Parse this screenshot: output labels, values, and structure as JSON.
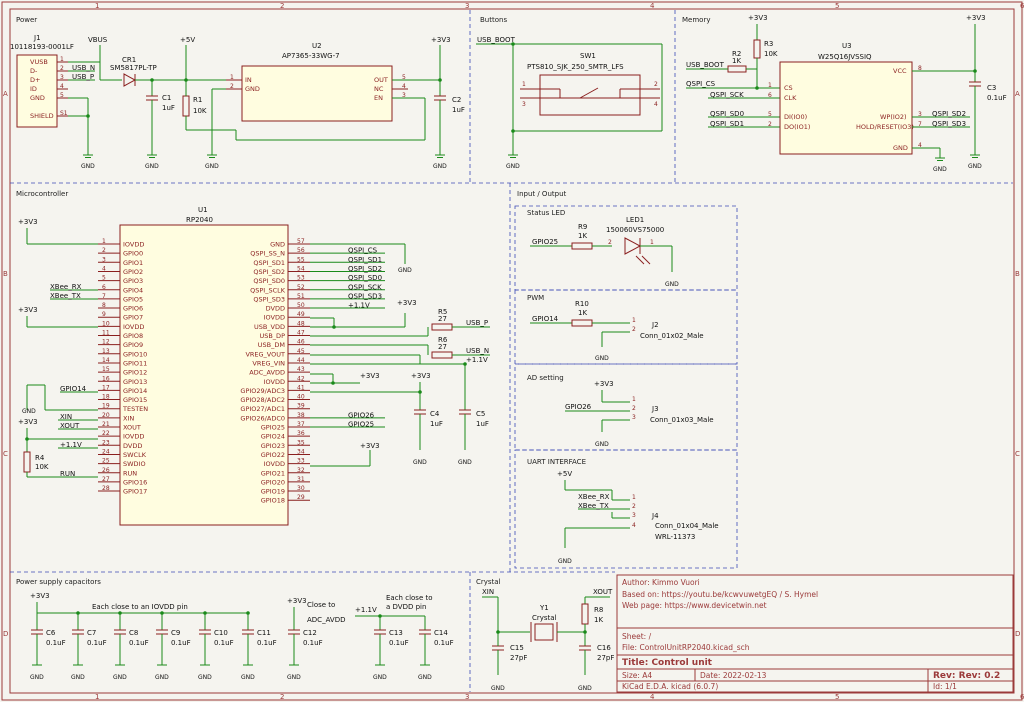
{
  "sections": {
    "power": "Power",
    "buttons": "Buttons",
    "memory": "Memory",
    "microcontroller": "Microcontroller",
    "io": "Input / Output",
    "status_led": "Status LED",
    "pwm": "PWM",
    "ad_setting": "AD setting",
    "uart": "UART INTERFACE",
    "power_caps": "Power supply capacitors",
    "crystal": "Crystal"
  },
  "grid_cols": [
    "1",
    "2",
    "3",
    "4",
    "5",
    "6"
  ],
  "grid_rows": [
    "A",
    "B",
    "C",
    "D"
  ],
  "power": {
    "j1_ref": "J1",
    "j1_val": "10118193-0001LF",
    "j1_pins": [
      "VUSB",
      "D-",
      "D+",
      "ID",
      "GND",
      "SHIELD"
    ],
    "j1_pnums": [
      "1",
      "2",
      "3",
      "4",
      "5",
      "S1"
    ],
    "vbus": "VBUS",
    "usb_n": "USB_N",
    "usb_p": "USB_P",
    "cr1_ref": "CR1",
    "cr1_val": "SM5817PL-TP",
    "p5v": "+5V",
    "c1_ref": "C1",
    "c1_val": "1uF",
    "r1_ref": "R1",
    "r1_val": "10K",
    "u2_ref": "U2",
    "u2_val": "AP7365-33WG-7",
    "u2_left": [
      "IN",
      "GND"
    ],
    "u2_right": [
      "OUT",
      "NC",
      "EN"
    ],
    "u2_lnums": [
      "1",
      "2"
    ],
    "u2_rnums": [
      "5",
      "4",
      "3"
    ],
    "p3v3": "+3V3",
    "c2_ref": "C2",
    "c2_val": "1uF",
    "gnd": "GND"
  },
  "buttons": {
    "usb_boot": "USB_BOOT",
    "sw1_ref": "SW1",
    "sw1_val": "PTS810_SJK_250_SMTR_LFS",
    "pnums": [
      "1",
      "2",
      "3",
      "4"
    ]
  },
  "memory": {
    "p3v3": "+3V3",
    "r3_ref": "R3",
    "r3_val": "10K",
    "r2_ref": "R2",
    "r2_val": "1K",
    "usb_boot": "USB_BOOT",
    "qspi_cs": "QSPI_CS",
    "qspi_sck": "QSPI_SCK",
    "qspi_sd0": "QSPI_SD0",
    "qspi_sd1": "QSPI_SD1",
    "qspi_sd2": "QSPI_SD2",
    "qspi_sd3": "QSPI_SD3",
    "u3_ref": "U3",
    "u3_val": "W25Q16JVSSIQ",
    "u3_left": [
      "CS",
      "CLK",
      "DI(IO0)",
      "DO(IO1)"
    ],
    "u3_lnums": [
      "1",
      "6",
      "5",
      "2"
    ],
    "u3_right": [
      "VCC",
      "WP(IO2)",
      "HOLD/RESET(IO3)",
      "GND"
    ],
    "u3_rnums": [
      "8",
      "3",
      "7",
      "4"
    ],
    "c3_ref": "C3",
    "c3_val": "0.1uF",
    "gnd": "GND"
  },
  "mcu": {
    "u1_ref": "U1",
    "u1_val": "RP2040",
    "left_pins": [
      "IOVDD",
      "GPIO0",
      "GPIO1",
      "GPIO2",
      "GPIO3",
      "GPIO4",
      "GPIO5",
      "GPIO6",
      "GPIO7",
      "IOVDD",
      "GPIO8",
      "GPIO9",
      "GPIO10",
      "GPIO11",
      "GPIO12",
      "GPIO13",
      "GPIO14",
      "GPIO15",
      "TESTEN",
      "XIN",
      "XOUT",
      "IOVDD",
      "DVDD",
      "SWCLK",
      "SWDIO",
      "RUN",
      "GPIO16",
      "GPIO17"
    ],
    "left_nums": [
      "1",
      "2",
      "3",
      "4",
      "5",
      "6",
      "7",
      "8",
      "9",
      "10",
      "11",
      "12",
      "13",
      "14",
      "15",
      "16",
      "17",
      "18",
      "19",
      "20",
      "21",
      "22",
      "23",
      "24",
      "25",
      "26",
      "27",
      "28"
    ],
    "right_pins": [
      "GND",
      "QSPI_SS_N",
      "QSPI_SD1",
      "QSPI_SD2",
      "QSPI_SD0",
      "QSPI_SCLK",
      "QSPI_SD3",
      "DVDD",
      "IOVDD",
      "USB_VDD",
      "USB_DP",
      "USB_DM",
      "VREG_VOUT",
      "VREG_VIN",
      "ADC_AVDD",
      "IOVDD",
      "GPIO29/ADC3",
      "GPIO28/ADC2",
      "GPIO27/ADC1",
      "GPIO26/ADC0",
      "GPIO25",
      "GPIO24",
      "GPIO23",
      "GPIO22",
      "IOVDD",
      "GPIO21",
      "GPIO20",
      "GPIO19",
      "GPIO18"
    ],
    "right_nums": [
      "57",
      "56",
      "55",
      "54",
      "53",
      "52",
      "51",
      "50",
      "49",
      "48",
      "47",
      "46",
      "45",
      "44",
      "43",
      "42",
      "41",
      "40",
      "39",
      "38",
      "37",
      "36",
      "35",
      "34",
      "33",
      "32",
      "31",
      "30",
      "29"
    ],
    "right_nets": [
      "",
      "QSPI_CS",
      "QSPI_SD1",
      "QSPI_SD2",
      "QSPI_SD0",
      "QSPI_SCK",
      "QSPI_SD3",
      "+1.1V",
      "",
      "",
      "",
      "",
      "",
      "",
      "",
      "",
      "",
      "",
      "",
      "GPIO26",
      "GPIO25",
      "",
      "",
      "",
      "",
      "",
      "",
      "",
      ""
    ],
    "xbee_rx": "XBee_RX",
    "xbee_tx": "XBee_TX",
    "gpio14": "GPIO14",
    "xin": "XIN",
    "xout": "XOUT",
    "p1v1": "+1.1V",
    "run": "RUN",
    "p3v3": "+3V3",
    "r4_ref": "R4",
    "r4_val": "10K",
    "r5_ref": "R5",
    "r5_val": "27",
    "r6_ref": "R6",
    "r6_val": "27",
    "usb_p": "USB_P",
    "usb_n": "USB_N",
    "c4_ref": "C4",
    "c4_val": "1uF",
    "c5_ref": "C5",
    "c5_val": "1uF",
    "gnd": "GND"
  },
  "io": {
    "gpio25": "GPIO25",
    "r9_ref": "R9",
    "r9_val": "1K",
    "led1_ref": "LED1",
    "led1_val": "150060VS75000",
    "led_pnums": [
      "2",
      "1"
    ],
    "gpio14": "GPIO14",
    "r10_ref": "R10",
    "r10_val": "1K",
    "j2_ref": "J2",
    "j2_val": "Conn_01x02_Male",
    "p3v3": "+3V3",
    "gpio26": "GPIO26",
    "j3_ref": "J3",
    "j3_val": "Conn_01x03_Male",
    "p5v": "+5V",
    "xbee_rx": "XBee_RX",
    "xbee_tx": "XBee_TX",
    "j4_ref": "J4",
    "j4_val": "Conn_01x04_Male",
    "j4_part": "WRL-11373",
    "gnd": "GND"
  },
  "caps": {
    "p3v3": "+3V3",
    "note1": "Each close to an IOVDD pin",
    "note2": "Close to",
    "note2b": "ADC_AVDD",
    "p1v1": "+1.1V",
    "note3": "Each close to",
    "note3b": "a DVDD pin",
    "items": [
      {
        "ref": "C6",
        "val": "0.1uF"
      },
      {
        "ref": "C7",
        "val": "0.1uF"
      },
      {
        "ref": "C8",
        "val": "0.1uF"
      },
      {
        "ref": "C9",
        "val": "0.1uF"
      },
      {
        "ref": "C10",
        "val": "0.1uF"
      },
      {
        "ref": "C11",
        "val": "0.1uF"
      },
      {
        "ref": "C12",
        "val": "0.1uF"
      },
      {
        "ref": "C13",
        "val": "0.1uF"
      },
      {
        "ref": "C14",
        "val": "0.1uF"
      }
    ],
    "gnd": "GND"
  },
  "crystal": {
    "xin": "XIN",
    "xout": "XOUT",
    "y1_ref": "Y1",
    "y1_val": "Crystal",
    "r8_ref": "R8",
    "r8_val": "1K",
    "c15_ref": "C15",
    "c15_val": "27pF",
    "c16_ref": "C16",
    "c16_val": "27pF",
    "gnd": "GND"
  },
  "titleblock": {
    "author": "Author: Kimmo Vuori",
    "based": "Based on: https://youtu.be/kcwvuwetgEQ / S. Hymel",
    "web": "Web page: https://www.devicetwin.net",
    "sheet": "Sheet: /",
    "file": "File: ControlUnitRP2040.kicad_sch",
    "title": "Title: Control unit",
    "size": "Size: A4",
    "date": "Date: 2022-02-13",
    "rev": "Rev: Rev: 0.2",
    "tool": "KiCad E.D.A.  kicad (6.0.7)",
    "id": "Id: 1/1"
  }
}
